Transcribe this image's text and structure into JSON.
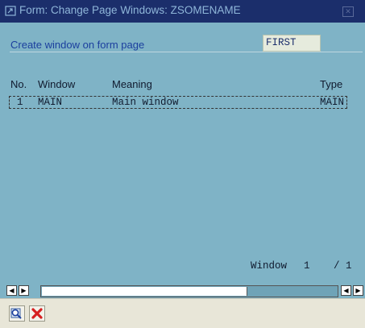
{
  "window": {
    "title": "Form: Change Page Windows: ZSOMENAME",
    "close_icon": "close-icon"
  },
  "form": {
    "label": "Create window on form page",
    "page_value": "FIRST"
  },
  "table": {
    "columns": [
      "No.",
      "Window",
      "Meaning",
      "Type"
    ],
    "rows": [
      {
        "no": "1",
        "window": "MAIN",
        "meaning": "Main window",
        "type": "MAIN"
      }
    ]
  },
  "pager": {
    "label": "Window",
    "current": "1",
    "total": "/ 1"
  },
  "toolbar": {
    "buttons": [
      "find-icon",
      "cancel-icon"
    ]
  },
  "colors": {
    "titlebar": "#1b2e6b",
    "background": "#7fb3c6",
    "label": "#1b3f9e",
    "cancel": "#d62020"
  }
}
